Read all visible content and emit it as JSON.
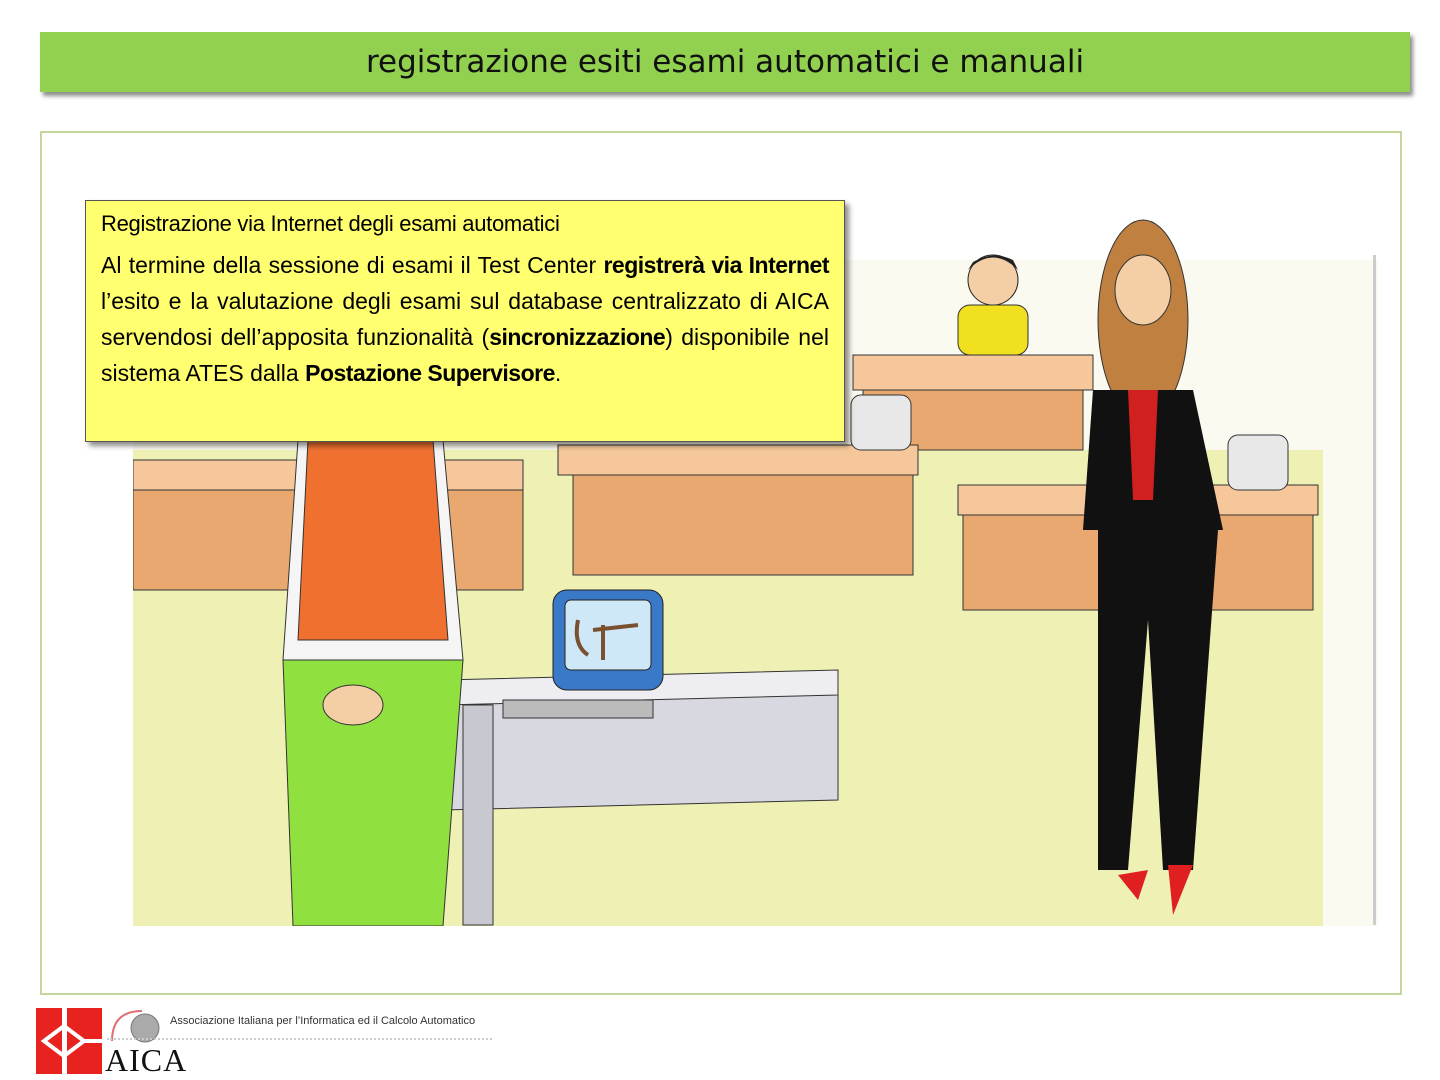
{
  "slide": {
    "title": "registrazione esiti esami automatici e manuali"
  },
  "callout": {
    "heading": "Registrazione via Internet degli esami automatici",
    "body": [
      {
        "text": "Al termine della sessione di esami il Test Center ",
        "bold": false
      },
      {
        "text": "registrerà via Internet",
        "bold": true
      },
      {
        "text": " l’esito e la valutazione degli esami sul database centralizzato di AICA servendosi dell’apposita funzionalità (",
        "bold": false
      },
      {
        "text": "sincronizzazione",
        "bold": true
      },
      {
        "text": ") disponibile nel sistema ATES dalla ",
        "bold": false
      },
      {
        "text": "Postazione Supervisore",
        "bold": true
      },
      {
        "text": ".",
        "bold": false
      }
    ]
  },
  "footer": {
    "logo_name": "AICA",
    "logo_tagline": "Associazione Italiana per l’Informatica ed il Calcolo Automatico"
  },
  "colors": {
    "title_bar": "#92d050",
    "frame_border": "#c3d69b",
    "callout_bg": "#ffff70",
    "logo_red": "#e8231f"
  }
}
